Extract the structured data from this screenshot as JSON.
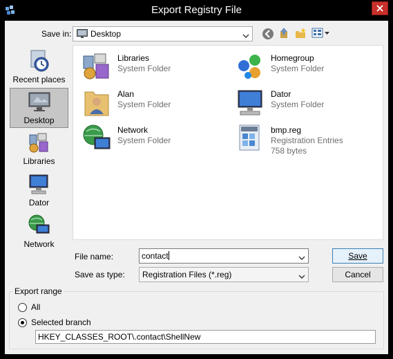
{
  "window": {
    "title": "Export Registry File"
  },
  "toolbar": {
    "save_in_label": "Save in:",
    "save_in_value": "Desktop"
  },
  "places": [
    {
      "label": "Recent places",
      "icon": "recent-places-icon",
      "selected": false
    },
    {
      "label": "Desktop",
      "icon": "desktop-icon",
      "selected": true
    },
    {
      "label": "Libraries",
      "icon": "libraries-icon",
      "selected": false
    },
    {
      "label": "Dator",
      "icon": "computer-icon",
      "selected": false
    },
    {
      "label": "Network",
      "icon": "network-icon",
      "selected": false
    }
  ],
  "files": [
    {
      "name": "Libraries",
      "type": "System Folder",
      "size": "",
      "icon": "libraries-icon"
    },
    {
      "name": "Homegroup",
      "type": "System Folder",
      "size": "",
      "icon": "homegroup-icon"
    },
    {
      "name": "Alan",
      "type": "System Folder",
      "size": "",
      "icon": "user-folder-icon"
    },
    {
      "name": "Dator",
      "type": "System Folder",
      "size": "",
      "icon": "computer-icon"
    },
    {
      "name": "Network",
      "type": "System Folder",
      "size": "",
      "icon": "network-icon"
    },
    {
      "name": "bmp.reg",
      "type": "Registration Entries",
      "size": "758 bytes",
      "icon": "reg-file-icon"
    }
  ],
  "form": {
    "file_name_label": "File name:",
    "file_name_value": "contact",
    "save_as_type_label": "Save as type:",
    "save_as_type_value": "Registration Files (*.reg)",
    "save_button": "Save",
    "cancel_button": "Cancel"
  },
  "export_range": {
    "title": "Export range",
    "all_label": "All",
    "selected_branch_label": "Selected branch",
    "selected": "Selected branch",
    "branch_path": "HKEY_CLASSES_ROOT\\.contact\\ShellNew"
  }
}
